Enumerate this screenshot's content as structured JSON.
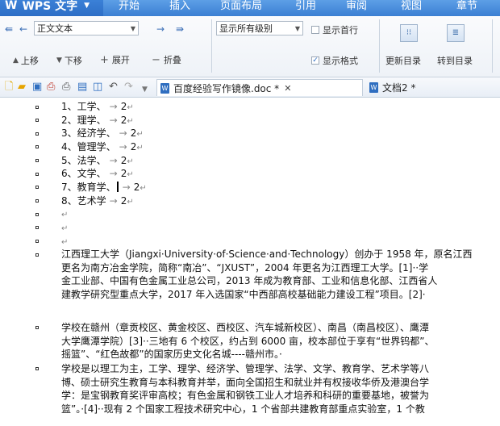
{
  "app": {
    "logo": "W",
    "name": "WPS 文字"
  },
  "menu": [
    "开始",
    "插入",
    "页面布局",
    "引用",
    "审阅",
    "视图",
    "章节"
  ],
  "ribbon": {
    "style_select": "正文文本",
    "level_select": "显示所有级别",
    "show_first_line": "显示首行",
    "show_format": "显示格式",
    "move_up": "上移",
    "move_down": "下移",
    "expand": "展开",
    "collapse": "折叠",
    "update_toc": "更新目录",
    "goto_toc": "转到目录"
  },
  "tabs": [
    {
      "label": "百度经验写作镜像.doc *",
      "close": "✕"
    },
    {
      "label": "文档2 *"
    }
  ],
  "list_items": [
    {
      "text": "1、工学、",
      "num": "2"
    },
    {
      "text": "2、理学、",
      "num": "2"
    },
    {
      "text": "3、经济学、",
      "num": "2"
    },
    {
      "text": "4、管理学、",
      "num": "2"
    },
    {
      "text": "5、法学、",
      "num": "2"
    },
    {
      "text": "6、文学、",
      "num": "2"
    },
    {
      "text": "7、教育学、",
      "num": "2"
    },
    {
      "text": "8、艺术学",
      "num": "2"
    }
  ],
  "paragraphs": [
    [
      "江西理工大学（Jiangxi·University·of·Science·and·Technology）创办于 1958 年，原名江西",
      "更名为南方冶金学院，简称“南冶”、“JXUST”，2004 年更名为江西理工大学。[1]··学",
      "金工业部、中国有色金属工业总公司，2013 年成为教育部、工业和信息化部、江西省人",
      "建教学研究型重点大学，2017 年入选国家“中西部高校基础能力建设工程”项目。[2]·"
    ],
    [
      "学校在赣州（章贡校区、黄金校区、西校区、汽车城新校区）、南昌（南昌校区）、鹰潭",
      "大学鹰潭学院）[3]··三地有 6 个校区，约占到 6000 亩，校本部位于享有“世界钨都”、",
      "摇篮”、“红色故都”的国家历史文化名城----赣州市。·"
    ],
    [
      "学校是以理工为主，工学、理学、经济学、管理学、法学、文学、教育学、艺术学等八",
      "博、硕士研究生教育与本科教育并举，面向全国招生和就业并有权接收华侨及港澳台学",
      "学：是宝钢教育奖评审高校；有色金属和钢铁工业人才培养和科研的重要基地，被誉为",
      "篮”。·[4]··现有 2 个国家工程技术研究中心，1 个省部共建教育部重点实验室，1 个教"
    ]
  ]
}
